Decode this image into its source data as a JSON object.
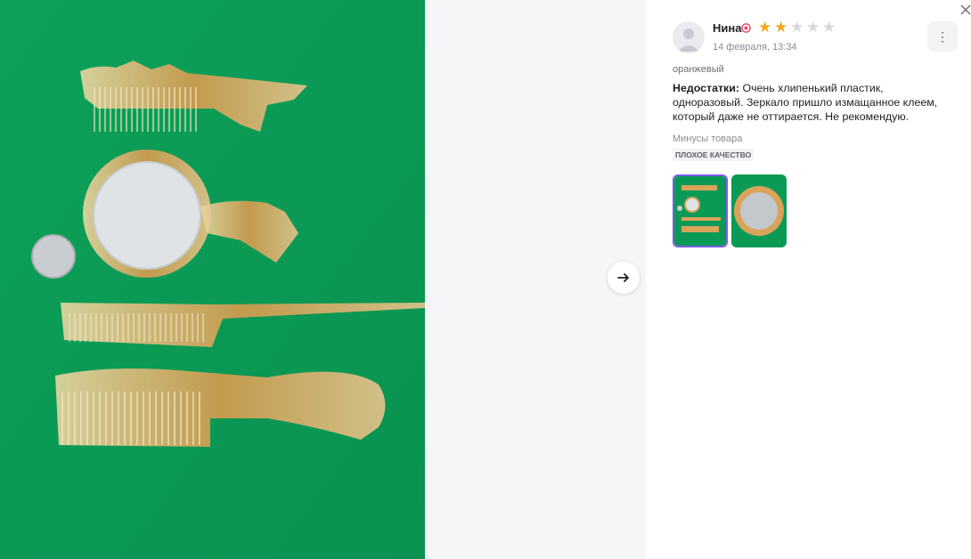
{
  "photo": {
    "alt_icon": "product-photo"
  },
  "navigation": {
    "next_icon": "arrow-right-icon"
  },
  "review": {
    "user_name": "Нина",
    "rating": 2,
    "rating_max": 5,
    "date": "14 февраля, 13:34",
    "variant": "оранжевый",
    "cons_label": "Недостатки:",
    "cons_text": "Очень хлипенький пластик, одноразовый. Зеркало пришло измащанное клеем, который даже не оттирается. Не рекомендую.",
    "cons_section_title": "Минусы товара",
    "tags": [
      "ПЛОХОЕ КАЧЕСТВО"
    ]
  },
  "colors": {
    "accent": "#7b5ce6",
    "star": "#f5a623",
    "star_off": "#d5d7dc",
    "photo_bg": "#0b9a55"
  }
}
